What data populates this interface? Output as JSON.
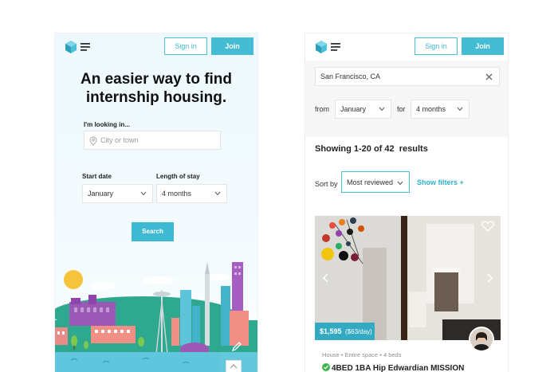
{
  "left": {
    "header": {
      "signin_label": "Sign in",
      "join_label": "Join"
    },
    "hero": {
      "title_line1": "An easier way to find",
      "title_line2": "internship housing."
    },
    "form": {
      "looking_label": "I'm looking in...",
      "city_placeholder": "City or town",
      "start_date_label": "Start date",
      "start_date_value": "January",
      "length_label": "Length of stay",
      "length_value": "4 months",
      "search_label": "Search"
    }
  },
  "right": {
    "header": {
      "signin_label": "Sign in",
      "join_label": "Join"
    },
    "search": {
      "value": "San Francisco, CA"
    },
    "filters": {
      "from_label": "from",
      "from_value": "January",
      "for_label": "for",
      "for_value": "4 months"
    },
    "results_text": "Showing 1-20 of 42  results",
    "sort": {
      "label": "Sort by",
      "value": "Most reviewed",
      "show_filters": "Show filters +"
    },
    "listing": {
      "price": "$1,595",
      "price_sub": "($63/day)",
      "meta": "House  •  Entire space  •  4 beds",
      "title": "4BED 1BA Hip Edwardian MISSION"
    }
  },
  "colors": {
    "accent": "#43bcd4",
    "accent_dark": "#33a9c2",
    "verified": "#3bb54a"
  }
}
